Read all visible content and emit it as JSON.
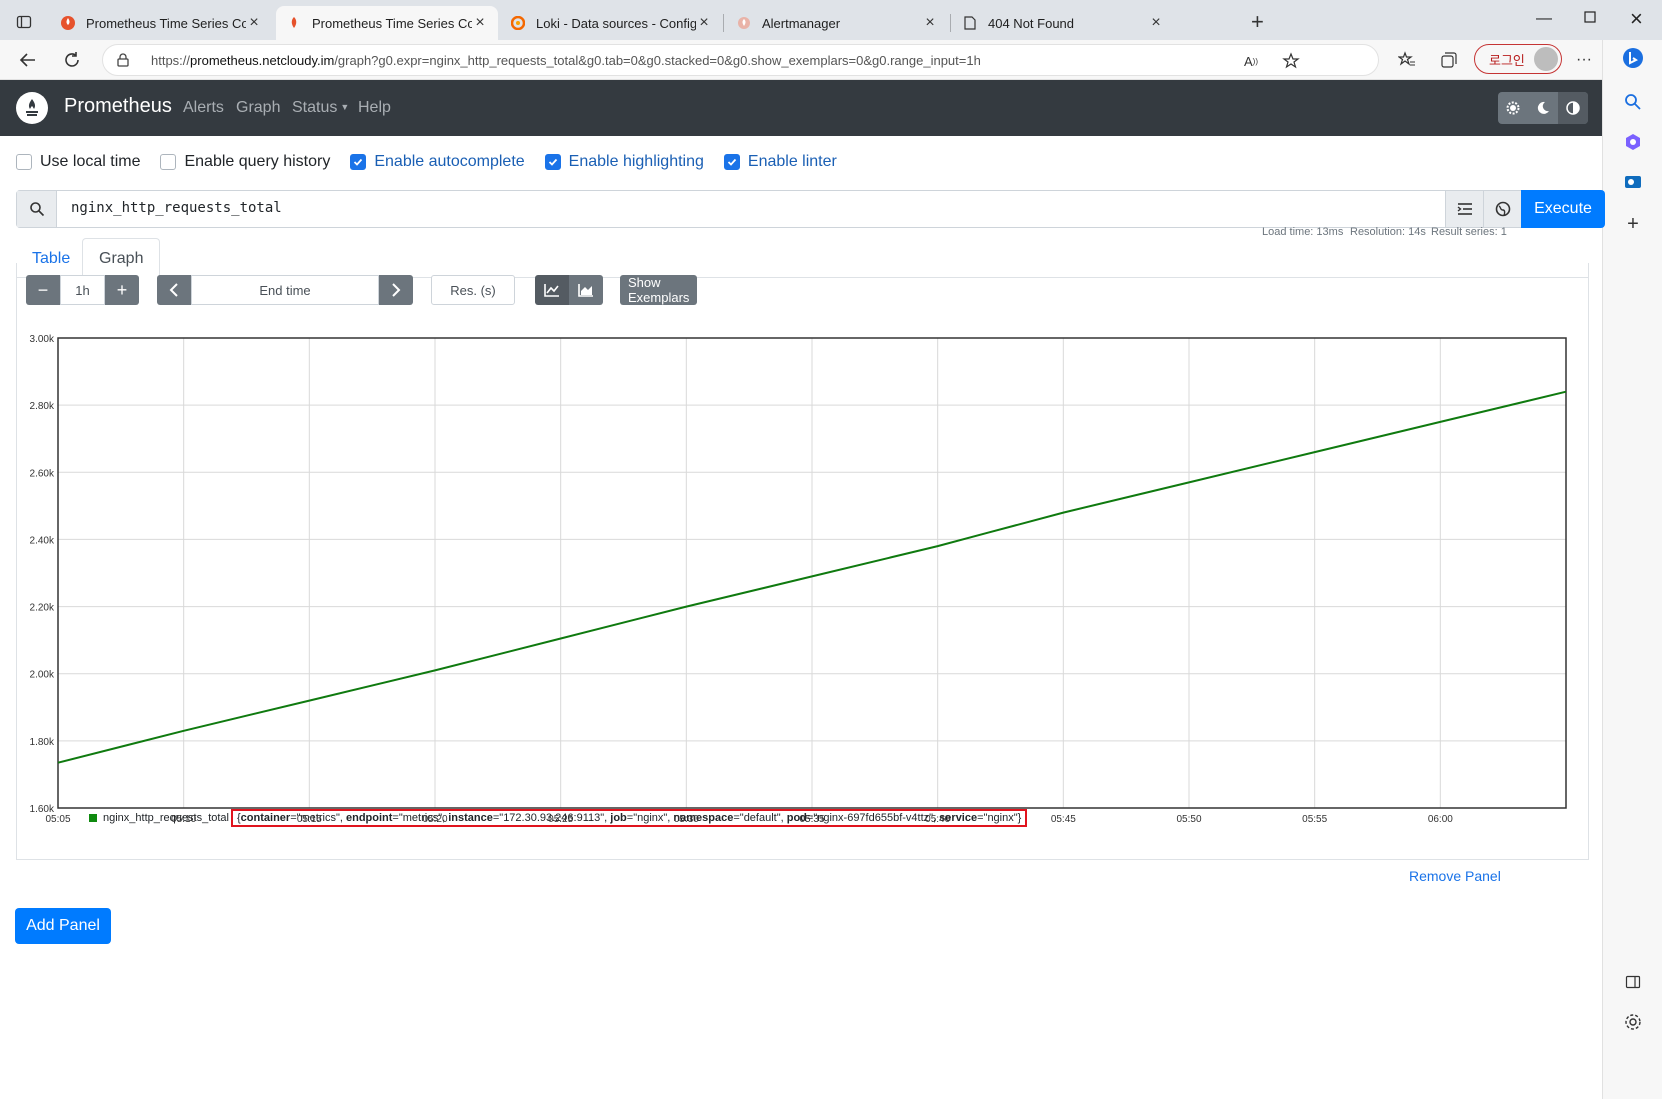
{
  "browser": {
    "tabs": [
      {
        "title": "Prometheus Time Series Collectio",
        "active": false
      },
      {
        "title": "Prometheus Time Series Collectio",
        "active": true
      },
      {
        "title": "Loki - Data sources - Configurati",
        "active": false
      },
      {
        "title": "Alertmanager",
        "active": false
      },
      {
        "title": "404 Not Found",
        "active": false
      }
    ],
    "url_prefix": "https://",
    "url_host": "prometheus.netcloudy.im",
    "url_rest": "/graph?g0.expr=nginx_http_requests_total&g0.tab=0&g0.stacked=0&g0.show_exemplars=0&g0.range_input=1h",
    "login_label": "로그인"
  },
  "navbar": {
    "brand": "Prometheus",
    "links": [
      "Alerts",
      "Graph",
      "Status",
      "Help"
    ]
  },
  "options": [
    {
      "label": "Use local time",
      "checked": false
    },
    {
      "label": "Enable query history",
      "checked": false
    },
    {
      "label": "Enable autocomplete",
      "checked": true
    },
    {
      "label": "Enable highlighting",
      "checked": true
    },
    {
      "label": "Enable linter",
      "checked": true
    }
  ],
  "query": {
    "expr": "nginx_http_requests_total",
    "execute_label": "Execute"
  },
  "panel_tabs": {
    "table": "Table",
    "graph": "Graph"
  },
  "stats": {
    "load_time": "Load time: 13ms",
    "resolution": "Resolution: 14s",
    "result_series": "Result series: 1"
  },
  "graph_controls": {
    "range": "1h",
    "end_time_placeholder": "End time",
    "resolution_placeholder": "Res. (s)",
    "exemplars_label": "Show Exemplars"
  },
  "chart_data": {
    "type": "line",
    "x_ticks": [
      "05:05",
      "05:10",
      "05:15",
      "05:20",
      "05:25",
      "05:30",
      "05:35",
      "05:40",
      "05:45",
      "05:50",
      "05:55",
      "06:00"
    ],
    "y_ticks": [
      "1.60k",
      "1.80k",
      "2.00k",
      "2.20k",
      "2.40k",
      "2.60k",
      "2.80k",
      "3.00k"
    ],
    "ylim": [
      1600,
      3000
    ],
    "xlim_minutes": [
      "05:05",
      "06:05"
    ],
    "grid": true,
    "series": [
      {
        "name": "nginx_http_requests_total",
        "color": "#0f7a0f",
        "x": [
          "05:05",
          "05:10",
          "05:15",
          "05:20",
          "05:25",
          "05:30",
          "05:35",
          "05:40",
          "05:42",
          "05:43",
          "05:45",
          "05:50",
          "05:55",
          "06:00",
          "06:05"
        ],
        "values": [
          1735,
          1830,
          1920,
          2010,
          2105,
          2200,
          2290,
          2380,
          2420,
          2440,
          2480,
          2570,
          2660,
          2750,
          2840
        ]
      }
    ]
  },
  "legend": {
    "metric": "nginx_http_requests_total",
    "labels": [
      {
        "key": "container",
        "value": "\"metrics\""
      },
      {
        "key": "endpoint",
        "value": "\"metrics\""
      },
      {
        "key": "instance",
        "value": "\"172.30.93.246:9113\""
      },
      {
        "key": "job",
        "value": "\"nginx\""
      },
      {
        "key": "namespace",
        "value": "\"default\""
      },
      {
        "key": "pod",
        "value": "\"nginx-697fd655bf-v4ttz\""
      },
      {
        "key": "service",
        "value": "\"nginx\""
      }
    ]
  },
  "remove_panel_label": "Remove Panel",
  "add_panel_label": "Add Panel"
}
